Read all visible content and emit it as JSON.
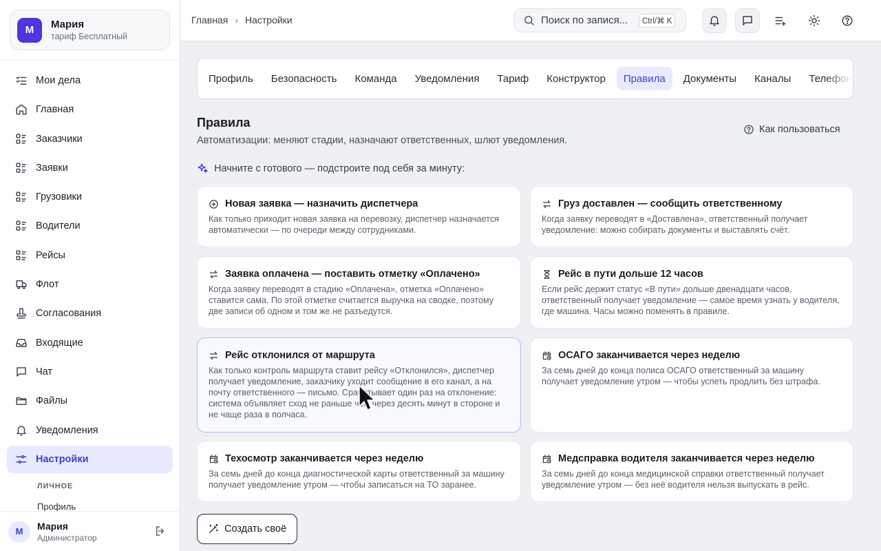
{
  "account": {
    "initial": "М",
    "name": "Мария",
    "plan": "тариф Бесплатный"
  },
  "nav": [
    {
      "label": "Мои дела",
      "icon": "tasks-icon"
    },
    {
      "label": "Главная",
      "icon": "home-icon"
    },
    {
      "label": "Заказчики",
      "icon": "list-icon"
    },
    {
      "label": "Заявки",
      "icon": "list-icon"
    },
    {
      "label": "Грузовики",
      "icon": "list-icon"
    },
    {
      "label": "Водители",
      "icon": "list-icon"
    },
    {
      "label": "Рейсы",
      "icon": "list-icon"
    },
    {
      "label": "Флот",
      "icon": "truck-icon"
    },
    {
      "label": "Согласования",
      "icon": "stamp-icon"
    },
    {
      "label": "Входящие",
      "icon": "inbox-icon"
    },
    {
      "label": "Чат",
      "icon": "chat-icon"
    },
    {
      "label": "Файлы",
      "icon": "folder-icon"
    },
    {
      "label": "Уведомления",
      "icon": "bell-icon"
    },
    {
      "label": "Настройки",
      "icon": "sliders-icon",
      "active": true
    }
  ],
  "sidebar_sub": {
    "section": "ЛИЧНОЕ",
    "link": "Профиль"
  },
  "user": {
    "initial": "М",
    "name": "Мария",
    "role": "Администратор"
  },
  "breadcrumb": {
    "home": "Главная",
    "current": "Настройки"
  },
  "search": {
    "placeholder": "Поиск по запися...",
    "shortcut": "Ctrl/⌘ K"
  },
  "tabs": [
    "Профиль",
    "Безопасность",
    "Команда",
    "Уведомления",
    "Тариф",
    "Конструктор",
    "Правила",
    "Документы",
    "Каналы",
    "Телефония"
  ],
  "active_tab": "Правила",
  "page": {
    "title": "Правила",
    "subtitle": "Автоматизации: меняют стадии, назначают ответственных, шлют уведомления.",
    "howto": "Как пользоваться",
    "hint": "Начните с готового — подстроите под себя за минуту:"
  },
  "templates": [
    {
      "icon": "plus-circle-icon",
      "title": "Новая заявка — назначить диспетчера",
      "desc": "Как только приходит новая заявка на перевозку, диспетчер назначается автоматически — по очереди между сотрудниками."
    },
    {
      "icon": "swap-icon",
      "title": "Груз доставлен — сообщить ответственному",
      "desc": "Когда заявку переводят в «Доставлена», ответственный получает уведомление: можно собирать документы и выставлять счёт."
    },
    {
      "icon": "swap-icon",
      "title": "Заявка оплачена — поставить отметку «Оплачено»",
      "desc": "Когда заявку переводят в стадию «Оплачена», отметка «Оплачено» ставится сама. По этой отметке считается выручка на сводке, поэтому две записи об одном и том же не разъедутся."
    },
    {
      "icon": "hourglass-icon",
      "title": "Рейс в пути дольше 12 часов",
      "desc": "Если рейс держит статус «В пути» дольше двенадцати часов, ответственный получает уведомление — самое время узнать у водителя, где машина. Часы можно поменять в правиле."
    },
    {
      "icon": "swap-icon",
      "title": "Рейс отклонился от маршрута",
      "desc": "Как только контроль маршрута ставит рейсу «Отклонился», диспетчер получает уведомление, заказчику уходит сообщение в его канал, а на почту ответственного — письмо. Срабатывает один раз на отклонение: система объявляет сход не раньше чем через десять минут в стороне и не чаще раза в полчаса."
    },
    {
      "icon": "calendar-clock-icon",
      "title": "ОСАГО заканчивается через неделю",
      "desc": "За семь дней до конца полиса ОСАГО ответственный за машину получает уведомление утром — чтобы успеть продлить без штрафа."
    },
    {
      "icon": "calendar-clock-icon",
      "title": "Техосмотр заканчивается через неделю",
      "desc": "За семь дней до конца диагностической карты ответственный за машину получает уведомление утром — чтобы записаться на ТО заранее."
    },
    {
      "icon": "calendar-clock-icon",
      "title": "Медсправка водителя заканчивается через неделю",
      "desc": "За семь дней до конца медицинской справки ответственный получает уведомление утром — без неё водителя нельзя выпускать в рейс."
    }
  ],
  "create_button": "Создать своё"
}
